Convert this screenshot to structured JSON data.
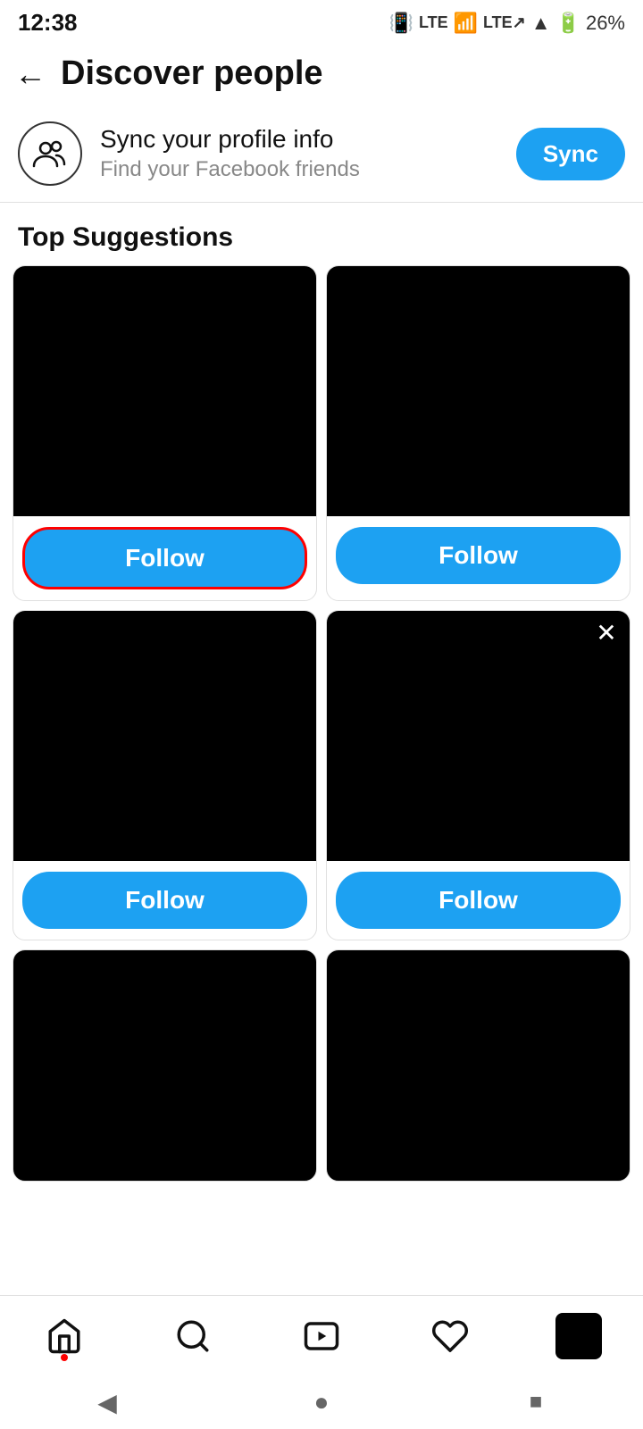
{
  "status": {
    "time": "12:38",
    "battery": "26%",
    "icons": "vibrate lte wifi lte signal signal battery"
  },
  "header": {
    "back_label": "←",
    "title": "Discover people"
  },
  "sync": {
    "title": "Sync your profile info",
    "subtitle": "Find your Facebook friends",
    "button_label": "Sync"
  },
  "section": {
    "top_suggestions": "Top Suggestions"
  },
  "cards": [
    {
      "id": 1,
      "highlighted": true,
      "follow_label": "Follow",
      "has_close": false
    },
    {
      "id": 2,
      "highlighted": false,
      "follow_label": "Follow",
      "has_close": false
    },
    {
      "id": 3,
      "highlighted": false,
      "follow_label": "Follow",
      "has_close": false
    },
    {
      "id": 4,
      "highlighted": false,
      "follow_label": "Follow",
      "has_close": true
    }
  ],
  "bottom_nav": {
    "items": [
      {
        "id": "home",
        "icon": "home-icon",
        "has_dot": true
      },
      {
        "id": "search",
        "icon": "search-icon",
        "has_dot": false
      },
      {
        "id": "video",
        "icon": "video-icon",
        "has_dot": false
      },
      {
        "id": "likes",
        "icon": "heart-icon",
        "has_dot": false
      },
      {
        "id": "profile",
        "icon": "profile-avatar",
        "has_dot": false
      }
    ]
  },
  "system_nav": {
    "back": "◀",
    "home": "●",
    "recent": "■"
  }
}
